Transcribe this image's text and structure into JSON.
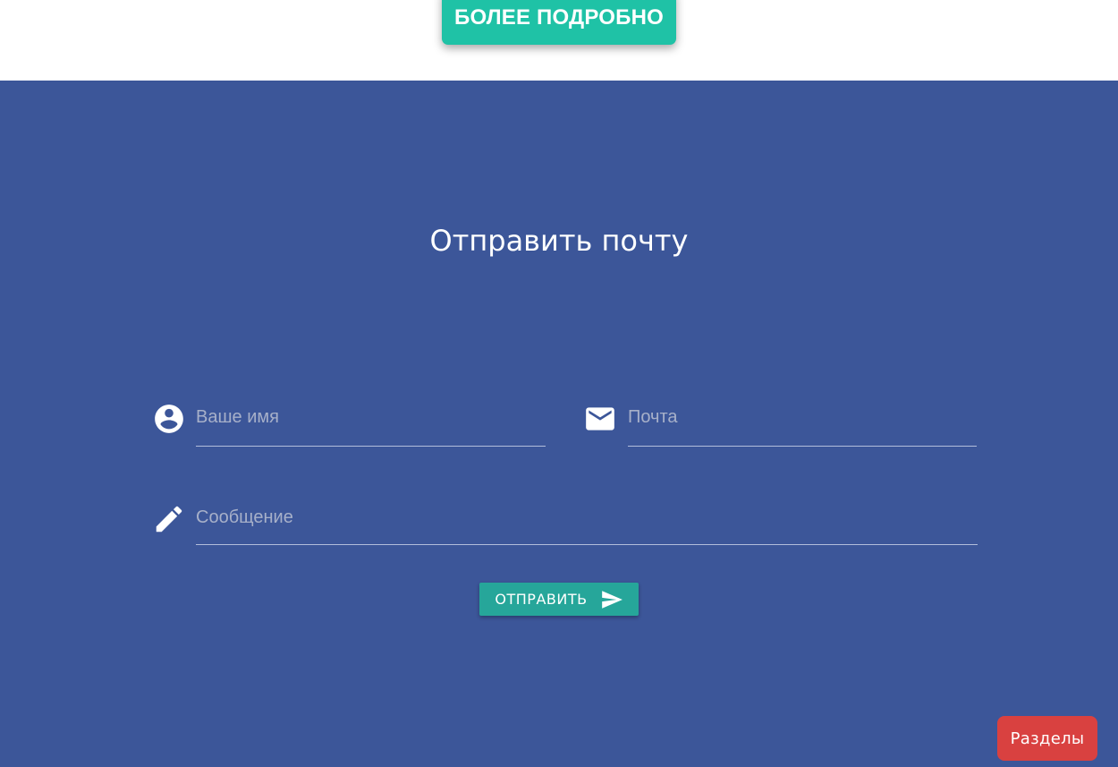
{
  "header": {
    "more_button_label": "БОЛЕЕ ПОДРОБНО"
  },
  "contact": {
    "title": "Отправить почту",
    "fields": {
      "name": {
        "placeholder": "Ваше имя",
        "value": "",
        "icon": "account-circle-icon"
      },
      "email": {
        "placeholder": "Почта",
        "value": "",
        "icon": "mail-icon"
      },
      "message": {
        "placeholder": "Сообщение",
        "value": "",
        "icon": "pencil-icon"
      }
    },
    "send_button": {
      "label": "ОТПРАВИТЬ",
      "icon": "send-icon"
    }
  },
  "floating": {
    "sections_label": "Разделы"
  },
  "colors": {
    "section_background": "#3c5699",
    "more_button": "#1fc2a6",
    "send_button": "#26a69a",
    "sections_button": "#d94140"
  }
}
